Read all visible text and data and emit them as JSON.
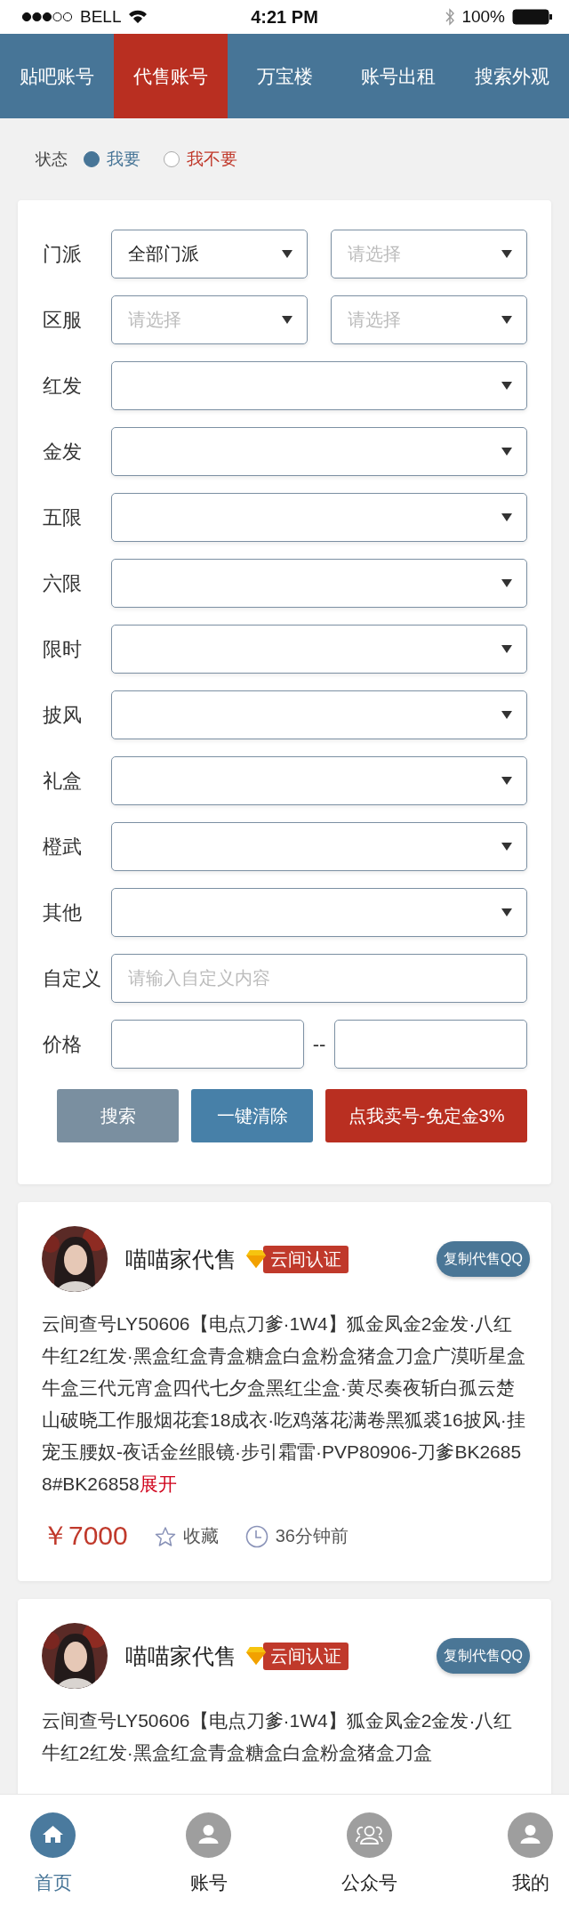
{
  "status_bar": {
    "carrier": "BELL",
    "time": "4:21 PM",
    "battery": "100%"
  },
  "tabs": [
    {
      "label": "贴吧账号",
      "selected": false
    },
    {
      "label": "代售账号",
      "selected": true
    },
    {
      "label": "万宝楼",
      "selected": false
    },
    {
      "label": "账号出租",
      "selected": false
    },
    {
      "label": "搜索外观",
      "selected": false
    }
  ],
  "status_filter": {
    "label": "状态",
    "options": [
      {
        "label": "我要",
        "selected": true
      },
      {
        "label": "我不要",
        "selected": false
      }
    ]
  },
  "filters": [
    {
      "label": "门派",
      "kind": "select_pair",
      "selects": [
        {
          "value": "全部门派"
        },
        {
          "placeholder": "请选择"
        }
      ]
    },
    {
      "label": "区服",
      "kind": "select_pair",
      "selects": [
        {
          "placeholder": "请选择"
        },
        {
          "placeholder": "请选择"
        }
      ]
    },
    {
      "label": "红发",
      "kind": "select"
    },
    {
      "label": "金发",
      "kind": "select"
    },
    {
      "label": "五限",
      "kind": "select"
    },
    {
      "label": "六限",
      "kind": "select"
    },
    {
      "label": "限时",
      "kind": "select"
    },
    {
      "label": "披风",
      "kind": "select"
    },
    {
      "label": "礼盒",
      "kind": "select"
    },
    {
      "label": "橙武",
      "kind": "select"
    },
    {
      "label": "其他",
      "kind": "select"
    },
    {
      "label": "自定义",
      "kind": "text",
      "placeholder": "请输入自定义内容"
    },
    {
      "label": "价格",
      "kind": "range",
      "separator": "--"
    }
  ],
  "buttons": [
    {
      "label": "搜索",
      "kind": "search"
    },
    {
      "label": "一键清除",
      "kind": "clear"
    },
    {
      "label": "点我卖号-免定金3%",
      "kind": "sell"
    }
  ],
  "listings": [
    {
      "seller": "喵喵家代售",
      "badge": "云间认证",
      "copy_button": "复制代售QQ",
      "description": "云间查号LY50606【电点刀爹·1W4】狐金凤金2金发·八红牛红2红发·黑盒红盒青盒糖盒白盒粉盒猪盒刀盒广漠听星盒牛盒三代元宵盒四代七夕盒黑红尘盒·黄尽奏夜斩白孤云楚山破晓工作服烟花套18成衣·吃鸡落花满卷黑狐裘16披风·挂宠玉腰奴-夜话金丝眼镜·步引霜雷·PVP80906-刀爹BK26858#BK26858",
      "expand_link": "展开",
      "price": "￥7000",
      "favorite_label": "收藏",
      "time": "36分钟前"
    },
    {
      "seller": "喵喵家代售",
      "badge": "云间认证",
      "copy_button": "复制代售QQ",
      "description": "云间查号LY50606【电点刀爹·1W4】狐金凤金2金发·八红牛红2红发·黑盒红盒青盒糖盒白盒粉盒猪盒刀盒"
    }
  ],
  "bottom_nav": [
    {
      "label": "首页",
      "kind": "home",
      "selected": true
    },
    {
      "label": "账号",
      "kind": "person",
      "selected": false
    },
    {
      "label": "公众号",
      "kind": "group",
      "selected": false
    },
    {
      "label": "我的",
      "kind": "person",
      "selected": false
    }
  ]
}
